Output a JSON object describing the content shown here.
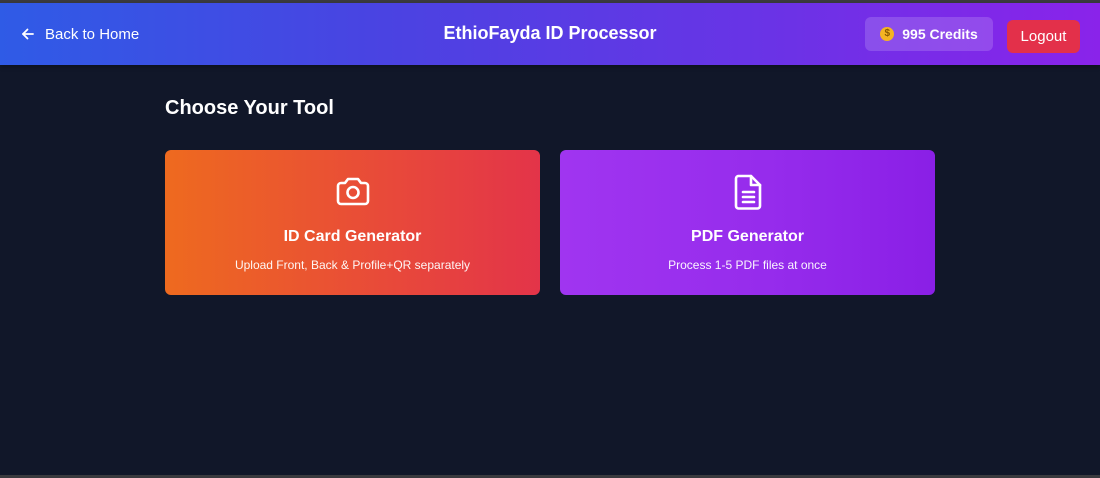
{
  "header": {
    "back_label": "Back to Home",
    "app_title": "EthioFayda ID Processor",
    "credits_label": "995 Credits",
    "logout_label": "Logout",
    "coin_glyph": "$"
  },
  "main": {
    "section_title": "Choose Your Tool",
    "tools": [
      {
        "title": "ID Card Generator",
        "description": "Upload Front, Back & Profile+QR separately",
        "icon": "camera-icon",
        "color_start": "#ee6a1f",
        "color_end": "#e33449"
      },
      {
        "title": "PDF Generator",
        "description": "Process 1-5 PDF files at once",
        "icon": "document-icon",
        "color_start": "#a035f0",
        "color_end": "#8a1fe6"
      }
    ]
  },
  "colors": {
    "background": "#111729",
    "header_start": "#2f5be6",
    "header_end": "#8a23ea",
    "logout": "#e3304a",
    "coin": "#f4b423"
  }
}
